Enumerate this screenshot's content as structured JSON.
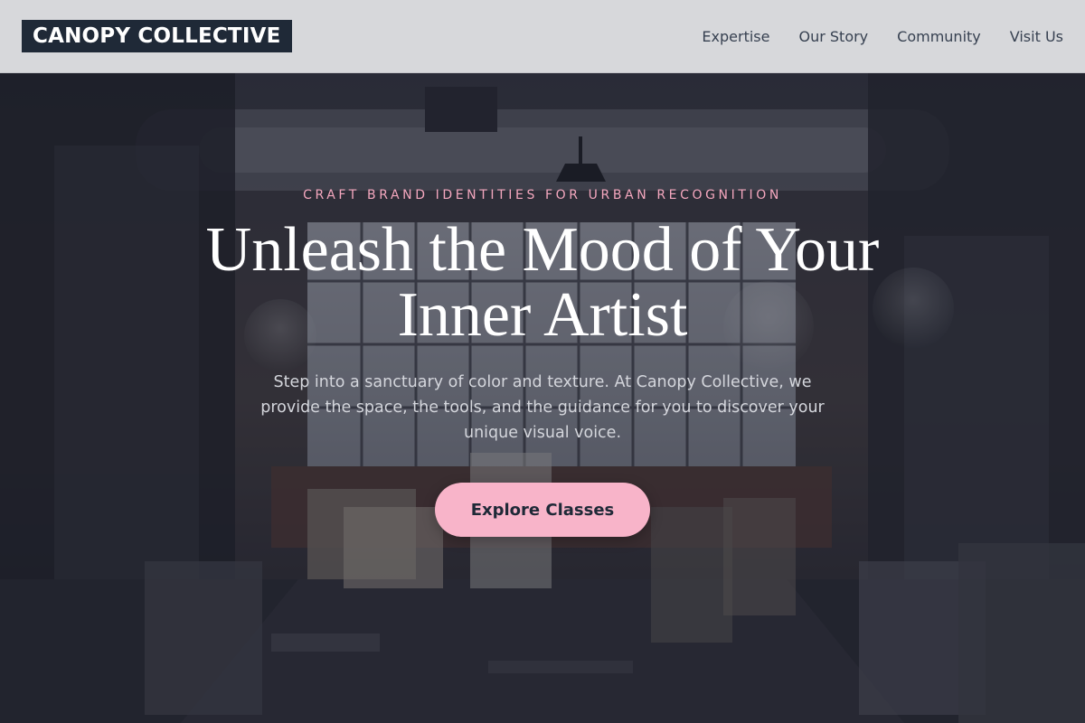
{
  "brand": {
    "name": "CANOPY COLLECTIVE"
  },
  "nav": {
    "items": [
      {
        "label": "Expertise"
      },
      {
        "label": "Our Story"
      },
      {
        "label": "Community"
      },
      {
        "label": "Visit Us"
      }
    ]
  },
  "hero": {
    "eyebrow": "CRAFT BRAND IDENTITIES FOR URBAN RECOGNITION",
    "headline_line1": "Unleash the Mood of Your",
    "headline_line2": "Inner Artist",
    "lede": "Step into a sanctuary of color and texture. At Canopy Collective, we provide the space, the tools, and the guidance for you to discover your unique visual voice.",
    "cta_label": "Explore Classes",
    "background": "dark-art-studio-photo"
  },
  "colors": {
    "header_bg": "#d7d8db",
    "logo_bg": "#1f2937",
    "logo_text": "#ffffff",
    "nav_text": "#374151",
    "accent_pink": "#f8b4c9",
    "eyebrow_pink": "#f4a7be",
    "headline": "#ffffff",
    "lede": "#d4d6dc"
  }
}
